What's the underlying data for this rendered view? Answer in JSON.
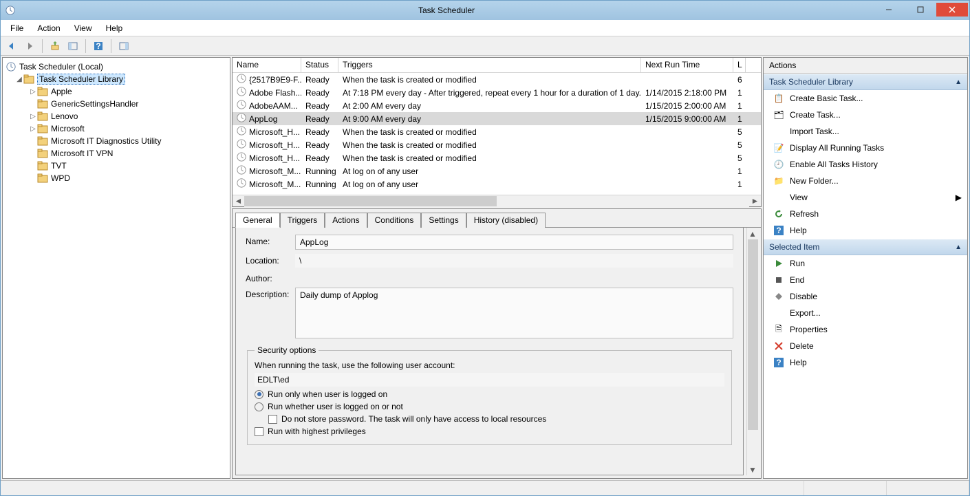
{
  "window": {
    "title": "Task Scheduler"
  },
  "menu": {
    "file": "File",
    "action": "Action",
    "view": "View",
    "help": "Help"
  },
  "tree": {
    "root": "Task Scheduler (Local)",
    "library": "Task Scheduler Library",
    "children": {
      "apple": "Apple",
      "generic": "GenericSettingsHandler",
      "lenovo": "Lenovo",
      "microsoft": "Microsoft",
      "msitdiag": "Microsoft IT Diagnostics Utility",
      "msitvpn": "Microsoft IT VPN",
      "tvt": "TVT",
      "wpd": "WPD"
    }
  },
  "columns": {
    "name": "Name",
    "status": "Status",
    "triggers": "Triggers",
    "next": "Next Run Time",
    "last": "L"
  },
  "tasks": [
    {
      "name": "{2517B9E9-F...",
      "status": "Ready",
      "trigger": "When the task is created or modified",
      "next": "",
      "last": "6"
    },
    {
      "name": "Adobe Flash...",
      "status": "Ready",
      "trigger": "At 7:18 PM every day - After triggered, repeat every 1 hour for a duration of 1 day.",
      "next": "1/14/2015 2:18:00 PM",
      "last": "1"
    },
    {
      "name": "AdobeAAM...",
      "status": "Ready",
      "trigger": "At 2:00 AM every day",
      "next": "1/15/2015 2:00:00 AM",
      "last": "1"
    },
    {
      "name": "AppLog",
      "status": "Ready",
      "trigger": "At 9:00 AM every day",
      "next": "1/15/2015 9:00:00 AM",
      "last": "1"
    },
    {
      "name": "Microsoft_H...",
      "status": "Ready",
      "trigger": "When the task is created or modified",
      "next": "",
      "last": "5"
    },
    {
      "name": "Microsoft_H...",
      "status": "Ready",
      "trigger": "When the task is created or modified",
      "next": "",
      "last": "5"
    },
    {
      "name": "Microsoft_H...",
      "status": "Ready",
      "trigger": "When the task is created or modified",
      "next": "",
      "last": "5"
    },
    {
      "name": "Microsoft_M...",
      "status": "Running",
      "trigger": "At log on of any user",
      "next": "",
      "last": "1"
    },
    {
      "name": "Microsoft_M...",
      "status": "Running",
      "trigger": "At log on of any user",
      "next": "",
      "last": "1"
    }
  ],
  "tabs": {
    "general": "General",
    "triggers": "Triggers",
    "actions": "Actions",
    "conditions": "Conditions",
    "settings": "Settings",
    "history": "History (disabled)"
  },
  "general": {
    "name_label": "Name:",
    "name_value": "AppLog",
    "location_label": "Location:",
    "location_value": "\\",
    "author_label": "Author:",
    "description_label": "Description:",
    "description_value": "Daily dump of Applog",
    "security_legend": "Security options",
    "security_text": "When running the task, use the following user account:",
    "security_account": "EDLT\\ed",
    "opt_logged_on": "Run only when user is logged on",
    "opt_logged_off": "Run whether user is logged on or not",
    "opt_no_password": "Do not store password.  The task will only have access to local resources",
    "opt_highest": "Run with highest privileges"
  },
  "actions": {
    "title": "Actions",
    "group_library": "Task Scheduler Library",
    "create_basic": "Create Basic Task...",
    "create_task": "Create Task...",
    "import_task": "Import Task...",
    "display_running": "Display All Running Tasks",
    "enable_history": "Enable All Tasks History",
    "new_folder": "New Folder...",
    "view": "View",
    "refresh": "Refresh",
    "help": "Help",
    "group_selected": "Selected Item",
    "run": "Run",
    "end": "End",
    "disable": "Disable",
    "export": "Export...",
    "properties": "Properties",
    "delete": "Delete",
    "help2": "Help"
  }
}
